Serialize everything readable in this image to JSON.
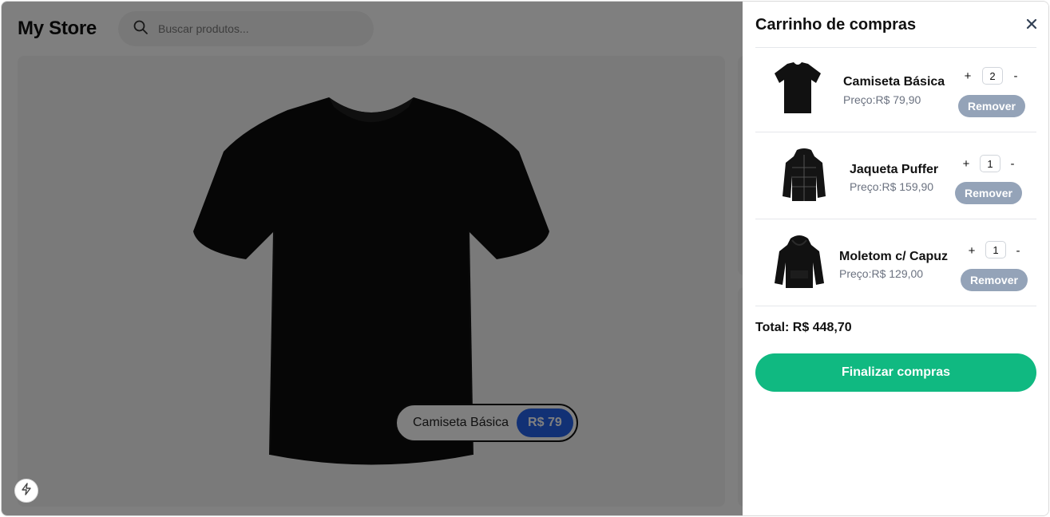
{
  "store": {
    "logo": "My Store",
    "search_placeholder": "Buscar produtos...",
    "icons": {
      "search": "search-icon",
      "bolt": "bolt-icon"
    },
    "hero": {
      "name": "Camiseta Básica",
      "price": "R$ 79"
    }
  },
  "cart": {
    "title": "Carrinho de compras",
    "close_icon": "close-icon",
    "items": [
      {
        "name": "Camiseta Básica",
        "price": "Preço:R$ 79,90",
        "quantity": "2",
        "plus": "+",
        "minus": "-",
        "remove": "Remover",
        "image": "tshirt-image"
      },
      {
        "name": "Jaqueta Puffer",
        "price": "Preço:R$ 159,90",
        "quantity": "1",
        "plus": "+",
        "minus": "-",
        "remove": "Remover",
        "image": "puffer-jacket-image"
      },
      {
        "name": "Moletom c/ Capuz",
        "price": "Preço:R$ 129,00",
        "quantity": "1",
        "plus": "+",
        "minus": "-",
        "remove": "Remover",
        "image": "hoodie-image"
      }
    ],
    "total": "Total: R$ 448,70",
    "checkout": "Finalizar compras"
  },
  "colors": {
    "checkout": "#10b981",
    "remove": "#94a3b8",
    "price_badge": "#2563eb",
    "overlay": "rgba(0,0,0,0.5)"
  }
}
